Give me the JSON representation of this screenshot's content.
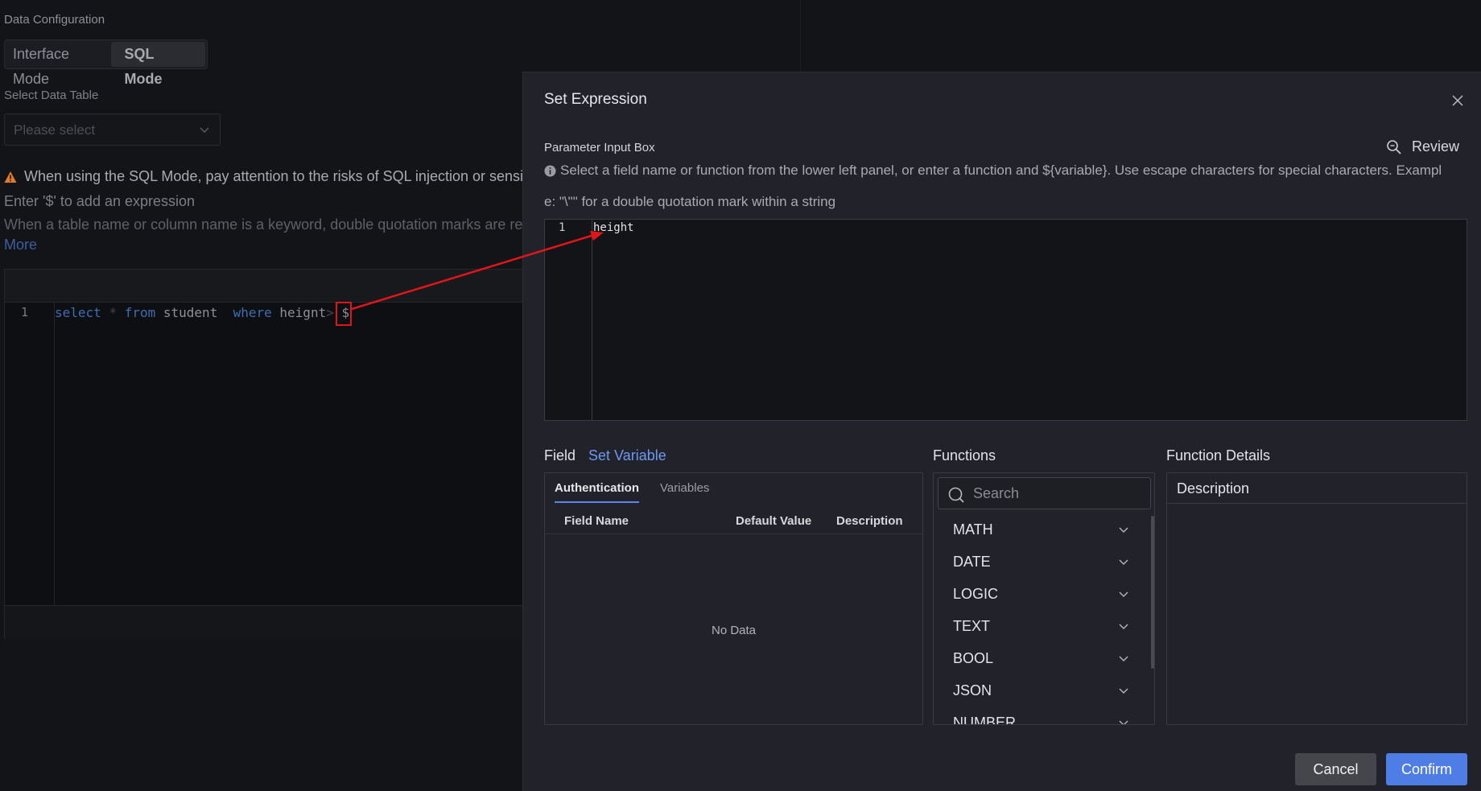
{
  "background": {
    "section_label": "Data Configuration",
    "mode_switch": {
      "interface": "Interface Mode",
      "sql": "SQL Mode",
      "active": "SQL Mode"
    },
    "select_table_label": "Select Data Table",
    "select_placeholder": "Please select",
    "warning": "When using the SQL Mode, pay attention to the risks of SQL injection or sensitiv",
    "hint_dollar": "Enter '$' to add an expression",
    "hint_keyword": "When a table name or column name is a keyword, double quotation marks are requ",
    "more_link": "More",
    "sql_editor": {
      "line_number": "1",
      "tokens": {
        "select": "select",
        "star": "*",
        "from": "from",
        "table": "student",
        "where": "where",
        "column": "heignt",
        "op": ">",
        "dollar": "$"
      }
    }
  },
  "drawer": {
    "title": "Set Expression",
    "param_label": "Parameter Input Box",
    "review_label": "Review",
    "info_line1": "Select a field name or function from the lower left panel, or enter a function and ${variable}. Use escape characters for special characters. Exampl",
    "info_line2": "e: \"\\\"\" for a double quotation mark within a string",
    "editor": {
      "line_number": "1",
      "code": "height"
    },
    "field": {
      "title": "Field",
      "set_variable": "Set Variable",
      "tabs": [
        {
          "label": "Authentication",
          "active": true
        },
        {
          "label": "Variables",
          "active": false
        }
      ],
      "columns": [
        "Field Name",
        "Default Value",
        "Description"
      ],
      "empty_text": "No Data"
    },
    "functions": {
      "title": "Functions",
      "search_placeholder": "Search",
      "items": [
        "MATH",
        "DATE",
        "LOGIC",
        "TEXT",
        "BOOL",
        "JSON",
        "NUMBER"
      ]
    },
    "details": {
      "title": "Function Details",
      "description_label": "Description"
    },
    "buttons": {
      "cancel": "Cancel",
      "confirm": "Confirm"
    }
  },
  "colors": {
    "accent": "#4f7de6",
    "link": "#6e97f2",
    "annotation": "#e0151a",
    "warning": "#e07b2e"
  },
  "icons": [
    "chevron-down-icon",
    "warning-icon",
    "close-icon",
    "review-icon",
    "info-icon",
    "search-icon"
  ]
}
